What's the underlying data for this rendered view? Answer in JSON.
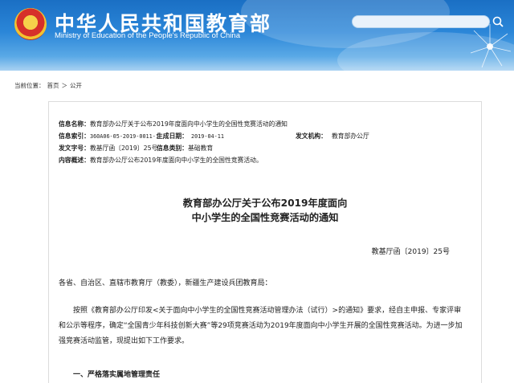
{
  "header": {
    "title": "中华人民共和国教育部",
    "subtitle": "Ministry of Education of the People's Republic of China"
  },
  "breadcrumb": {
    "label": "当前位置：",
    "home": "首页",
    "sep": "＞",
    "current": "公开"
  },
  "info": {
    "name_label": "信息名称：",
    "name_value": "教育部办公厅关于公布2019年度面向中小学生的全国性竞赛活动的通知",
    "index_label": "信息索引：",
    "index_value": "360A06-05-2019-0011-1",
    "date_label": "生成日期：",
    "date_value": "2019-04-11",
    "org_label": "发文机构：",
    "org_value": "教育部办公厅",
    "docno_label": "发文字号：",
    "docno_value": "教基厅函〔2019〕25号",
    "cat_label": "信息类别：",
    "cat_value": "基础教育",
    "summary_label": "内容概述：",
    "summary_value": "教育部办公厅公布2019年度面向中小学生的全国性竞赛活动。"
  },
  "document": {
    "title_line1": "教育部办公厅关于公布2019年度面向",
    "title_line2": "中小学生的全国性竞赛活动的通知",
    "doc_no": "教基厅函〔2019〕25号",
    "addressee": "各省、自治区、直辖市教育厅（教委），新疆生产建设兵团教育局：",
    "paragraph1": "按照《教育部办公厅印发<关于面向中小学生的全国性竞赛活动管理办法（试行）>的通知》要求，经自主申报、专家评审和公示等程序，确定“全国青少年科技创新大赛”等29项竞赛活动为2019年度面向中小学生开展的全国性竞赛活动。为进一步加强竞赛活动监管，现提出如下工作要求。",
    "section1": "一、严格落实属地管理责任"
  },
  "colors": {
    "header_blue": "#2b86d8",
    "text": "#222222"
  }
}
